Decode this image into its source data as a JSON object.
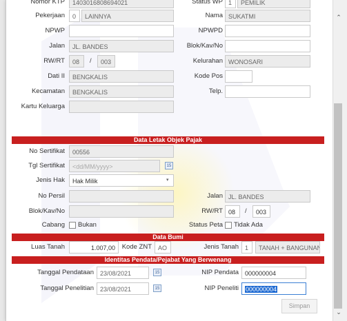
{
  "taxpayer": {
    "nomor_ktp_label": "Nomor KTP",
    "nomor_ktp": "1403016808694021",
    "status_wp_label": "Status WP",
    "status_wp_code": "1",
    "status_wp_value": "PEMILIK",
    "pekerjaan_label": "Pekerjaan",
    "pekerjaan_code": "0",
    "pekerjaan_value": "LAINNYA",
    "nama_label": "Nama",
    "nama": "SUKATMI",
    "npwp_label": "NPWP",
    "npwp": "",
    "npwpd_label": "NPWPD",
    "npwpd": "",
    "jalan_label": "Jalan",
    "jalan": "JL. BANDES",
    "blok_label": "Blok/Kav/No",
    "blok": "",
    "rwrt_label": "RW/RT",
    "rw": "08",
    "rt": "003",
    "slash": "/",
    "kelurahan_label": "Kelurahan",
    "kelurahan": "WONOSARI",
    "dati_label": "Dati II",
    "dati": "BENGKALIS",
    "kodepos_label": "Kode Pos",
    "kodepos": "",
    "kecamatan_label": "Kecamatan",
    "kecamatan": "BENGKALIS",
    "telp_label": "Telp.",
    "telp": "",
    "kk_label": "Kartu Keluarga",
    "kk": ""
  },
  "objek": {
    "header": "Data Letak Objek Pajak",
    "no_sertifikat_label": "No Sertifikat",
    "no_sertifikat": "00556",
    "tgl_sertifikat_label": "Tgl Sertifikat",
    "tgl_sertifikat_placeholder": "<dd/MM/yyyy>",
    "calendar_glyph": "15",
    "jenis_hak_label": "Jenis Hak",
    "jenis_hak": "Hak Milik",
    "dropdown_glyph": "▾",
    "no_persil_label": "No Persil",
    "no_persil": "",
    "jalan_label": "Jalan",
    "jalan": "JL. BANDES",
    "blok_label": "Blok/Kav/No",
    "blok": "",
    "rwrt_label": "RW/RT",
    "rw": "08",
    "rt": "003",
    "slash": "/",
    "cabang_label": "Cabang",
    "cabang_checkbox_label": "Bukan",
    "status_peta_label": "Status Peta",
    "status_peta_checkbox_label": "Tidak Ada"
  },
  "bumi": {
    "header": "Data Bumi",
    "luas_tanah_label": "Luas Tanah",
    "luas_tanah": "1.007,00",
    "kode_znt_label": "Kode ZNT",
    "kode_znt": "AO",
    "jenis_tanah_label": "Jenis Tanah",
    "jenis_tanah_code": "1",
    "jenis_tanah_value": "TANAH + BANGUNAN"
  },
  "pendata": {
    "header": "Identitas Pendata/Pejabat Yang Berwenang",
    "tgl_pendataan_label": "Tanggal Pendataan",
    "tgl_pendataan": "23/08/2021",
    "nip_pendata_label": "NIP Pendata",
    "nip_pendata": "000000004",
    "tgl_penelitian_label": "Tanggal Penelitian",
    "tgl_penelitian": "23/08/2021",
    "nip_peneliti_label": "NIP Peneliti",
    "nip_peneliti": "000000004"
  },
  "actions": {
    "simpan_label": "Simpan"
  },
  "scrollbar": {
    "up_glyph": "⌃",
    "down_glyph": "⌄"
  },
  "colors": {
    "section_header": "#c81f1f",
    "selection": "#1e6ad2",
    "scroll_thumb": "#c2c2c2"
  }
}
